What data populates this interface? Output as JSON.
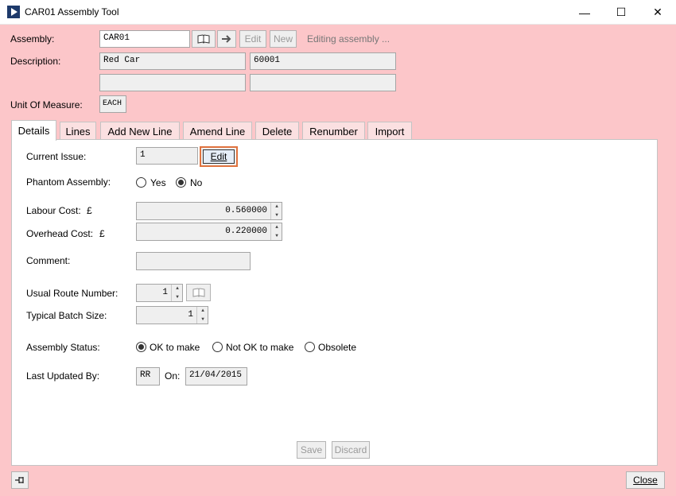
{
  "window": {
    "title": "CAR01 Assembly Tool",
    "minimize": "—",
    "maximize": "☐",
    "close": "✕"
  },
  "header": {
    "assembly_label": "Assembly:",
    "assembly_value": "CAR01",
    "edit_label": "Edit",
    "new_label": "New",
    "status_text": "Editing assembly ...",
    "description_label": "Description:",
    "description_1": "Red Car",
    "description_2": "60001",
    "description_3": "",
    "description_4": "",
    "uom_label": "Unit Of Measure:",
    "uom_value": "EACH"
  },
  "tabs": [
    "Details",
    "Lines",
    "Add New Line",
    "Amend Line",
    "Delete",
    "Renumber",
    "Import"
  ],
  "details": {
    "current_issue_label": "Current Issue:",
    "current_issue_value": "1",
    "current_issue_edit": "Edit",
    "phantom_label": "Phantom Assembly:",
    "phantom_yes": "Yes",
    "phantom_no": "No",
    "phantom_selected": "No",
    "labour_label": "Labour Cost:",
    "labour_currency": "£",
    "labour_value": "0.560000",
    "overhead_label": "Overhead Cost:",
    "overhead_currency": "£",
    "overhead_value": "0.220000",
    "comment_label": "Comment:",
    "comment_value": "",
    "route_label": "Usual Route Number:",
    "route_value": "1",
    "batch_label": "Typical Batch Size:",
    "batch_value": "1",
    "status_label": "Assembly Status:",
    "status_options": [
      "OK to make",
      "Not OK to make",
      "Obsolete"
    ],
    "status_selected": "OK to make",
    "updated_label": "Last Updated By:",
    "updated_by": "RR",
    "on_label": "On:",
    "updated_on": "21/04/2015",
    "save_label": "Save",
    "discard_label": "Discard"
  },
  "footer": {
    "close_label": "Close"
  },
  "icons": {
    "lookup": "book-icon",
    "go": "arrow-right-icon",
    "pin": "pin-icon"
  }
}
